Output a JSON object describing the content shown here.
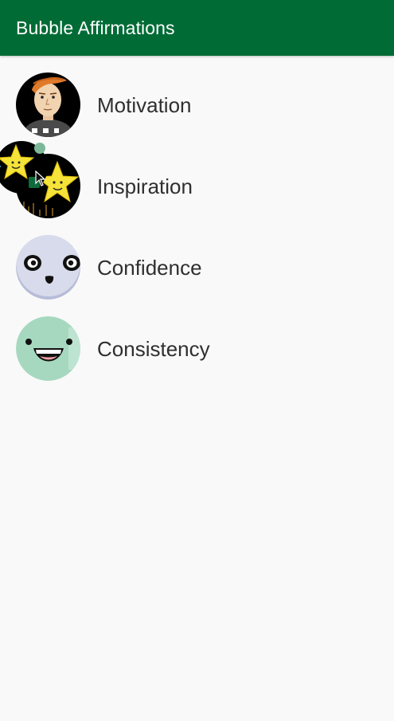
{
  "app_bar": {
    "title": "Bubble Affirmations",
    "color": "#006b35"
  },
  "list": {
    "items": [
      {
        "label": "Motivation",
        "icon": "cartoon-man-avatar"
      },
      {
        "label": "Inspiration",
        "icon": "smiling-stars-avatar"
      },
      {
        "label": "Confidence",
        "icon": "lavender-face-avatar"
      },
      {
        "label": "Consistency",
        "icon": "green-grin-avatar"
      }
    ]
  },
  "floating_bubble": {
    "icon": "smiling-star-bubble"
  },
  "colors": {
    "background": "#f9f9f9",
    "text": "#2f2f2f",
    "confidence_avatar": "#d6d9ea",
    "consistency_avatar": "#a6d8c0"
  }
}
